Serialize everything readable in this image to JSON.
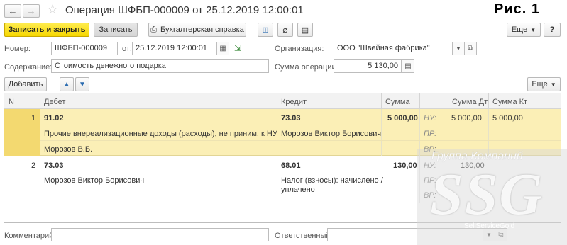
{
  "window": {
    "title": "Операция ШФБП-000009 от 25.12.2019 12:00:01",
    "caption": "Рис. 1"
  },
  "toolbar": {
    "save_close": "Записать и закрыть",
    "save": "Записать",
    "report": "Бухгалтерская справка",
    "more": "Еще"
  },
  "form": {
    "number_label": "Номер:",
    "number_value": "ШФБП-000009",
    "date_label": "от:",
    "date_value": "25.12.2019 12:00:01",
    "org_label": "Организация:",
    "org_value": "ООО \"Швейная фабрика\"",
    "content_label": "Содержание:",
    "content_value": "Стоимость денежного подарка",
    "sum_label": "Сумма операции:",
    "sum_value": "5 130,00"
  },
  "table_toolbar": {
    "add": "Добавить",
    "more": "Еще"
  },
  "table": {
    "headers": {
      "n": "N",
      "debit": "Дебет",
      "credit": "Кредит",
      "sum": "Сумма",
      "sum_dt": "Сумма Дт",
      "sum_kt": "Сумма Кт"
    },
    "rows": [
      {
        "n": "1",
        "debit_account": "91.02",
        "debit_sub1": "Прочие внереализационные доходы (расходы), не приним. к НУ",
        "debit_sub2": "Морозов В.Б.",
        "credit_account": "73.03",
        "credit_sub1": "Морозов Виктор Борисович",
        "sum": "5 000,00",
        "nu": "НУ:",
        "pr": "ПР:",
        "vr": "ВР:",
        "sum_dt": "5 000,00",
        "sum_kt": "5 000,00"
      },
      {
        "n": "2",
        "debit_account": "73.03",
        "debit_sub1": "Морозов Виктор Борисович",
        "credit_account": "68.01",
        "credit_sub1": "Налог (взносы): начислено /",
        "credit_sub2": "уплачено",
        "sum": "130,00",
        "nu": "НУ:",
        "pr": "ПР:",
        "vr": "ВР:",
        "sum_dt": "130,00"
      }
    ]
  },
  "footer": {
    "comment_label": "Комментарий:",
    "comment_value": "",
    "responsible_label": "Ответственный:",
    "responsible_value": ""
  },
  "watermark": {
    "top": "Группа Компаний",
    "logo": "SSG",
    "bottom": "SellServiceGold"
  },
  "colors": {
    "accent": "#f6d700",
    "selected_row": "#fbefb6",
    "grid_header": "#f2f2f2"
  }
}
